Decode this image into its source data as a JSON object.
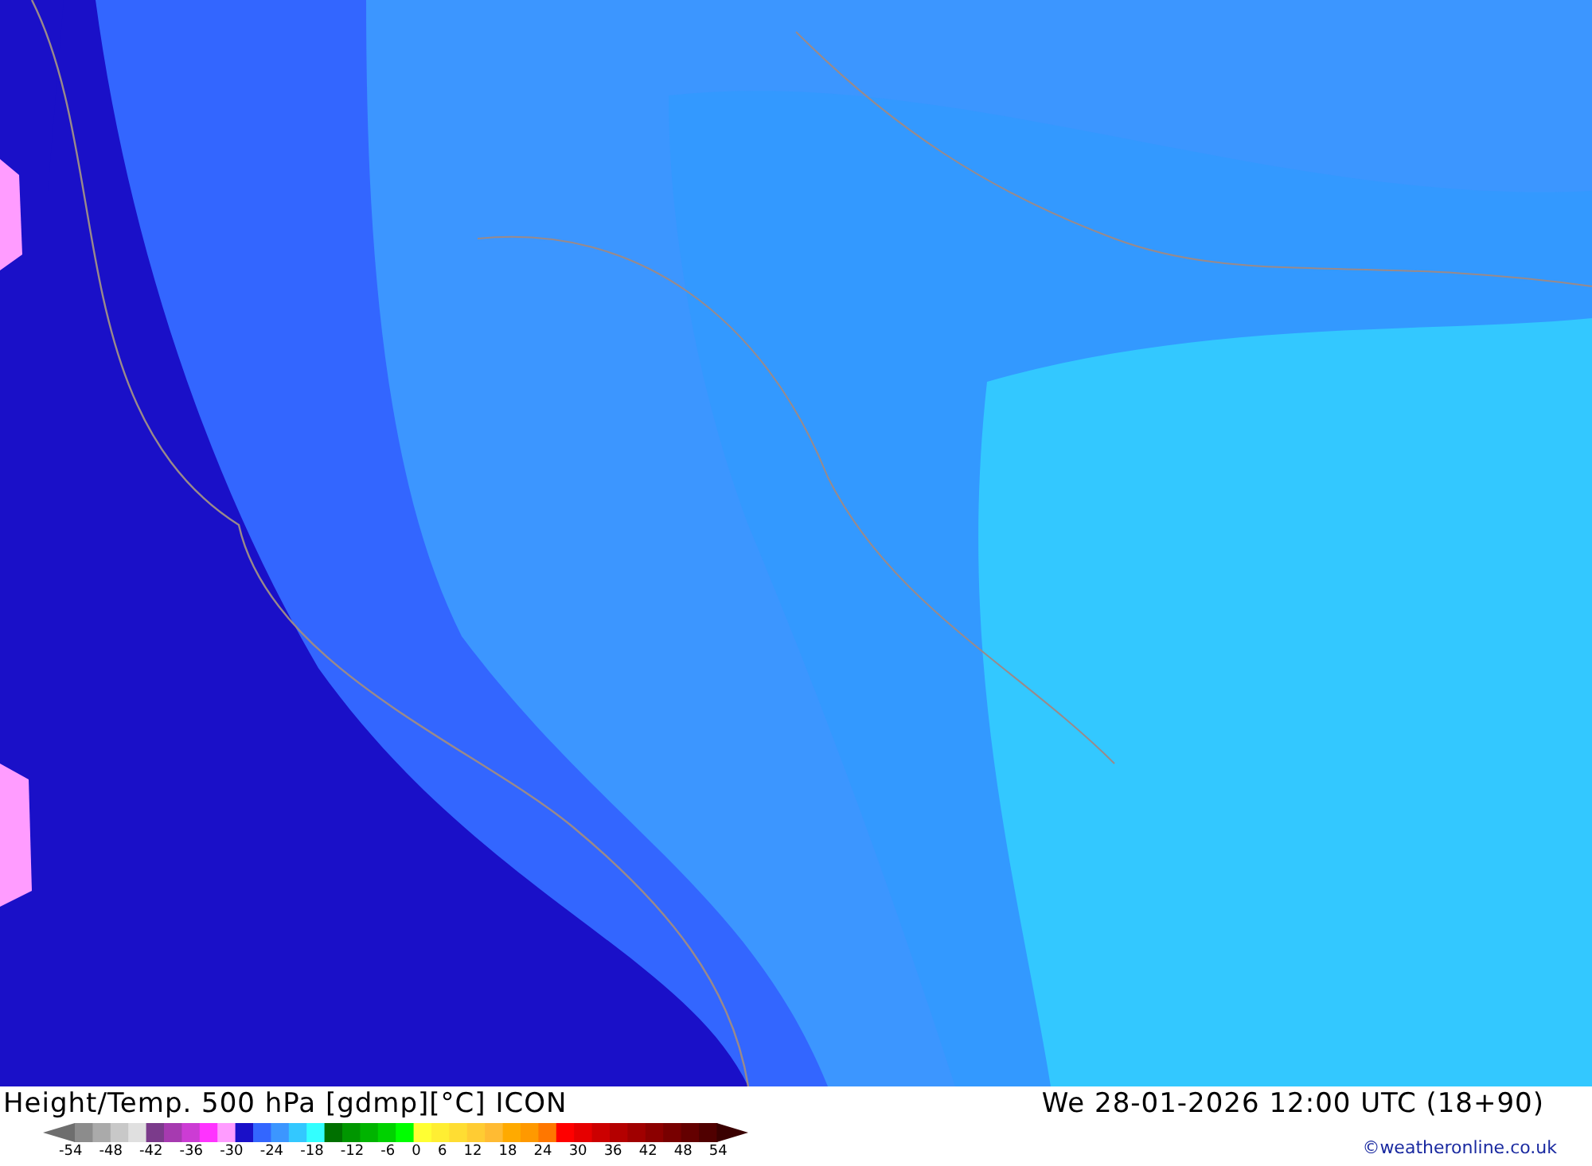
{
  "title": "Height/Temp. 500 hPa [gdmp][°C] ICON",
  "valid_time": "We 28-01-2026 12:00 UTC (18+90)",
  "legend": {
    "low_end": {
      "color": "#6e6e6e"
    },
    "high_end": {
      "color": "#3a0000"
    },
    "segments": [
      {
        "color": "#8c8c8c"
      },
      {
        "color": "#aaaaaa"
      },
      {
        "color": "#c8c8c8"
      },
      {
        "color": "#e0e0e0"
      },
      {
        "color": "#7b3b8b"
      },
      {
        "color": "#a63ab0"
      },
      {
        "color": "#cc3cd4"
      },
      {
        "color": "#ff33ff"
      },
      {
        "color": "#ff9cff"
      },
      {
        "color": "#1a10c8"
      },
      {
        "color": "#3366ff"
      },
      {
        "color": "#3c96ff"
      },
      {
        "color": "#33c8ff"
      },
      {
        "color": "#33ffff"
      },
      {
        "color": "#007000"
      },
      {
        "color": "#009600"
      },
      {
        "color": "#00b400"
      },
      {
        "color": "#00d200"
      },
      {
        "color": "#00ff00"
      },
      {
        "color": "#ffff33"
      },
      {
        "color": "#ffee33"
      },
      {
        "color": "#ffdd33"
      },
      {
        "color": "#ffcc33"
      },
      {
        "color": "#ffbb33"
      },
      {
        "color": "#ffaa00"
      },
      {
        "color": "#ff9900"
      },
      {
        "color": "#ff7700"
      },
      {
        "color": "#ff0000"
      },
      {
        "color": "#e60000"
      },
      {
        "color": "#cc0000"
      },
      {
        "color": "#b40000"
      },
      {
        "color": "#a00000"
      },
      {
        "color": "#8c0000"
      },
      {
        "color": "#780000"
      },
      {
        "color": "#640000"
      },
      {
        "color": "#500000"
      }
    ],
    "ticks": [
      "-54",
      "-48",
      "-42",
      "-36",
      "-30",
      "-24",
      "-18",
      "-12",
      "-6",
      "0",
      "6",
      "12",
      "18",
      "24",
      "30",
      "36",
      "42",
      "48",
      "54"
    ]
  },
  "credit": "©weatheronline.co.uk"
}
